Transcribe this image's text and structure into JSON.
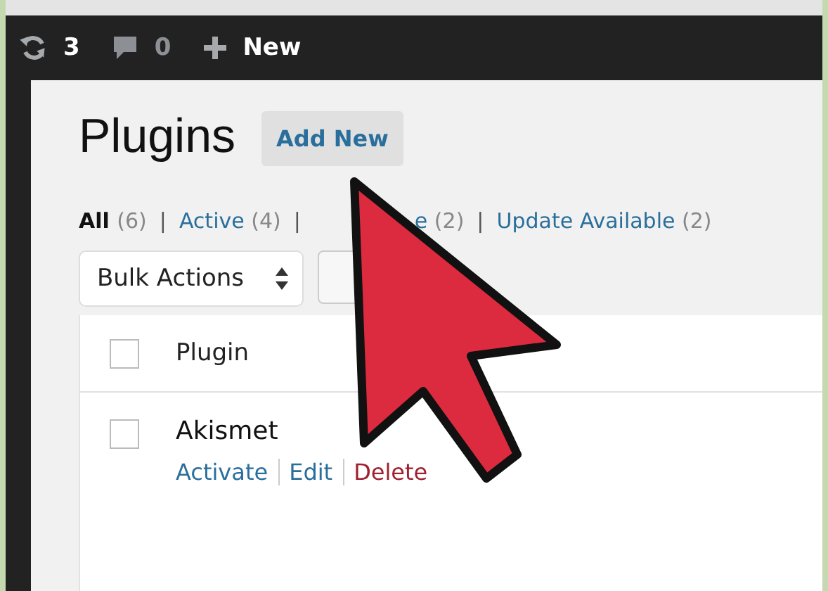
{
  "admin_bar": {
    "updates_count": "3",
    "comments_count": "0",
    "new_label": "New"
  },
  "page": {
    "title": "Plugins",
    "add_new_button": "Add New"
  },
  "filter_separator": "|",
  "filters": [
    {
      "label": "All",
      "count": "(6)",
      "selected": true
    },
    {
      "label": "Active",
      "count": "(4)",
      "selected": false
    },
    {
      "label": "e",
      "count": "(2)",
      "selected": false
    },
    {
      "label": "Update Available",
      "count": "(2)",
      "selected": false
    }
  ],
  "bulk_actions": {
    "value": "Bulk Actions"
  },
  "table": {
    "select_all_checked": false,
    "columns": [
      "Plugin"
    ],
    "rows": [
      {
        "name": "Akismet",
        "checked": false,
        "actions": [
          {
            "label": "Activate",
            "kind": "link"
          },
          {
            "label": "Edit",
            "kind": "link"
          },
          {
            "label": "Delete",
            "kind": "delete"
          }
        ]
      }
    ]
  }
}
